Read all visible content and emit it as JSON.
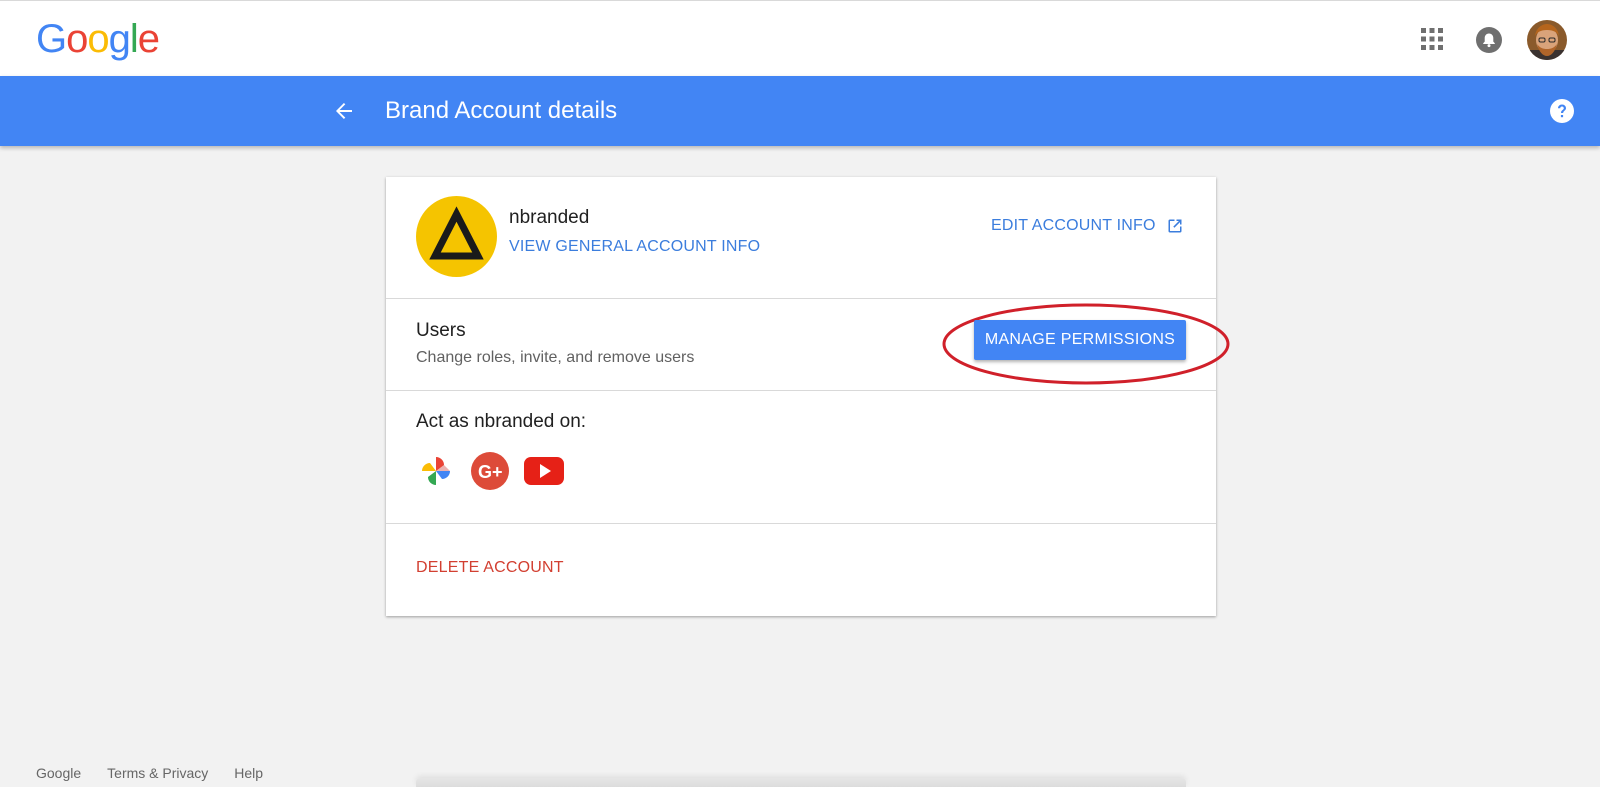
{
  "header": {
    "logo_letters": [
      "G",
      "o",
      "o",
      "g",
      "l",
      "e"
    ]
  },
  "appbar": {
    "title": "Brand Account details",
    "color": "#4285f4"
  },
  "account": {
    "name": "nbranded",
    "view_link": "VIEW GENERAL ACCOUNT INFO",
    "edit_link": "EDIT ACCOUNT INFO",
    "avatar_color": "#f5c400"
  },
  "users": {
    "title": "Users",
    "description": "Change roles, invite, and remove users",
    "manage_button": "MANAGE PERMISSIONS"
  },
  "act_as": {
    "title": "Act as nbranded on:",
    "services": [
      "google-photos-icon",
      "google-plus-icon",
      "youtube-icon"
    ]
  },
  "delete": {
    "label": "DELETE ACCOUNT",
    "color": "#d23f31"
  },
  "footer": {
    "links": [
      "Google",
      "Terms & Privacy",
      "Help"
    ]
  },
  "colors": {
    "link": "#3b7ddd",
    "highlight_ring": "#d0202a"
  }
}
